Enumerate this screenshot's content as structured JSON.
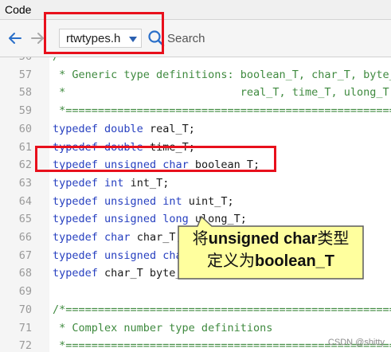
{
  "window": {
    "title": "Code"
  },
  "toolbar": {
    "file_selector": "rtwtypes.h",
    "search_placeholder": "Search"
  },
  "editor": {
    "lines": [
      {
        "num": "56",
        "code": "/*",
        "type": "comment"
      },
      {
        "num": "57",
        "code": " * Generic type definitions: boolean_T, char_T, byte_T,",
        "type": "comment"
      },
      {
        "num": "58",
        "code": " *                           real_T, time_T, ulong_T,",
        "type": "comment"
      },
      {
        "num": "59",
        "code": " *=======================================================",
        "type": "comment"
      },
      {
        "num": "60",
        "code": "typedef double real_T;",
        "type": "code"
      },
      {
        "num": "61",
        "code": "typedef double time_T;",
        "type": "code"
      },
      {
        "num": "62",
        "code": "typedef unsigned char boolean_T;",
        "type": "code"
      },
      {
        "num": "63",
        "code": "typedef int int_T;",
        "type": "code"
      },
      {
        "num": "64",
        "code": "typedef unsigned int uint_T;",
        "type": "code"
      },
      {
        "num": "65",
        "code": "typedef unsigned long ulong_T;",
        "type": "code"
      },
      {
        "num": "66",
        "code": "typedef char char_T;",
        "type": "code"
      },
      {
        "num": "67",
        "code": "typedef unsigned char uchar_T;",
        "type": "code"
      },
      {
        "num": "68",
        "code": "typedef char_T byte_T;",
        "type": "code"
      },
      {
        "num": "69",
        "code": "",
        "type": "code"
      },
      {
        "num": "70",
        "code": "/*=======================================================",
        "type": "comment"
      },
      {
        "num": "71",
        "code": " * Complex number type definitions",
        "type": "comment"
      },
      {
        "num": "72",
        "code": " *=======================================================",
        "type": "comment"
      }
    ]
  },
  "callout": {
    "line1_prefix": "将",
    "line1_bold": "unsigned char",
    "line1_suffix": "类型",
    "line2_prefix": "定义为",
    "line2_bold": "boolean_T"
  },
  "watermark": "CSDN @shitty",
  "colors": {
    "keyword": "#2740c0",
    "comment": "#3f8a3f",
    "annotation_red": "#e8101c",
    "callout_fill": "#ffff9e"
  }
}
